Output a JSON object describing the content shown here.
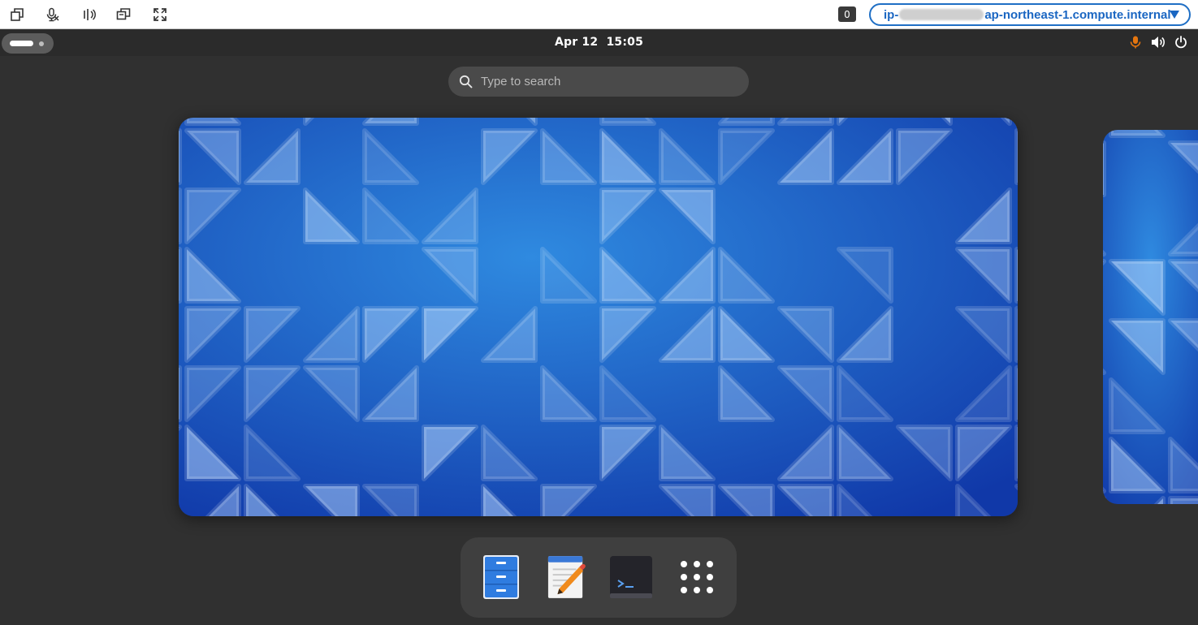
{
  "toolbar": {
    "buttons": [
      {
        "name": "restore-window-button",
        "icon": "windows-icon"
      },
      {
        "name": "mic-button",
        "icon": "microphone-mute-icon"
      },
      {
        "name": "audio-button",
        "icon": "speaker-waves-icon"
      },
      {
        "name": "multi-display-button",
        "icon": "displays-icon"
      },
      {
        "name": "fullscreen-button",
        "icon": "expand-arrows-icon"
      }
    ],
    "badge_count": "0",
    "host": {
      "prefix": "ip-",
      "suffix": "ap-northeast-1.compute.internal"
    }
  },
  "topbar": {
    "date": "Apr 12",
    "time": "15:05",
    "tray_icons": [
      "microphone-icon",
      "volume-icon",
      "power-icon"
    ],
    "mic_color": "#e5760f"
  },
  "search": {
    "placeholder": "Type to search"
  },
  "workspaces": [
    {
      "name": "current-workspace",
      "wallpaper": "blue-geometric-triangles"
    },
    {
      "name": "next-workspace",
      "wallpaper": "blue-geometric-triangles"
    }
  ],
  "dash": {
    "apps": [
      {
        "name": "files",
        "icon": "file-cabinet-icon"
      },
      {
        "name": "text-editor",
        "icon": "notepad-pencil-icon"
      },
      {
        "name": "terminal",
        "icon": "terminal-icon"
      },
      {
        "name": "show-apps",
        "icon": "app-grid-icon"
      }
    ]
  },
  "colors": {
    "accent": "#1a66c2",
    "desktop_bg": "#303030",
    "wallpaper_dark": "#1038a8",
    "wallpaper_light": "#2f8ae0"
  }
}
